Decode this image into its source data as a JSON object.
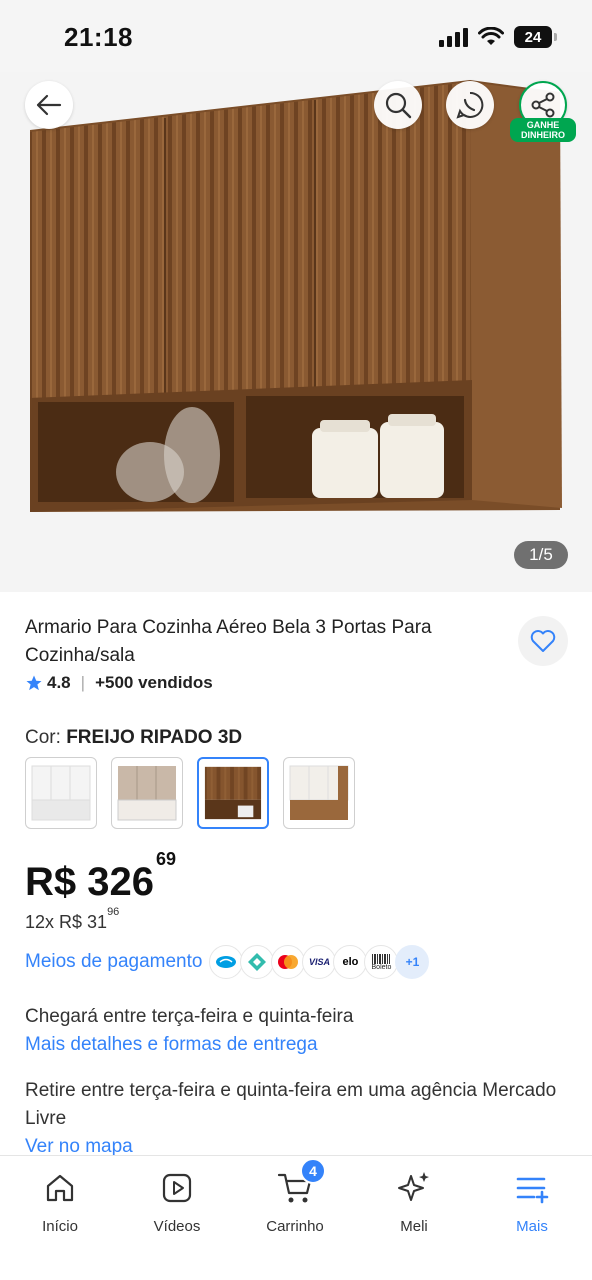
{
  "status_bar": {
    "time": "21:18",
    "battery": "24"
  },
  "gallery": {
    "page_indicator": "1/5",
    "earn_badge": "GANHE DINHEIRO"
  },
  "product": {
    "title": "Armario Para Cozinha Aéreo Bela 3 Portas Para Cozinha/sala",
    "rating": "4.8",
    "sold": "+500 vendidos",
    "color_label": "Cor:",
    "color_value": "FREIJO RIPADO 3D",
    "swatches": [
      "white",
      "beige",
      "freijo-ripado",
      "white-wood"
    ],
    "selected_swatch": "freijo-ripado",
    "price_main": "R$ 326",
    "price_cents": "69",
    "installments_text": "12x R$ 31",
    "installments_cents": "96"
  },
  "payments": {
    "link": "Meios de pagamento",
    "icons": [
      "mercadopago-icon",
      "pix-icon",
      "mastercard-icon",
      "visa-icon",
      "elo-icon",
      "boleto-icon"
    ],
    "visa": "VISA",
    "elo": "elo",
    "boleto": "Boleto",
    "more": "+1"
  },
  "delivery": {
    "text": "Chegará entre terça-feira e quinta-feira",
    "link": "Mais detalhes e formas de entrega"
  },
  "pickup": {
    "text": "Retire entre terça-feira e quinta-feira em uma agência Mercado Livre",
    "link": "Ver no mapa"
  },
  "nav": {
    "items": [
      {
        "label": "Início",
        "icon": "home-icon"
      },
      {
        "label": "Vídeos",
        "icon": "video-icon"
      },
      {
        "label": "Carrinho",
        "icon": "cart-icon"
      },
      {
        "label": "Meli",
        "icon": "sparkle-icon"
      },
      {
        "label": "Mais",
        "icon": "menu-plus-icon"
      }
    ],
    "cart_count": "4",
    "active": "Mais"
  },
  "colors": {
    "accent": "#3483fa",
    "green": "#00a650",
    "wood": "#8a5a32"
  }
}
